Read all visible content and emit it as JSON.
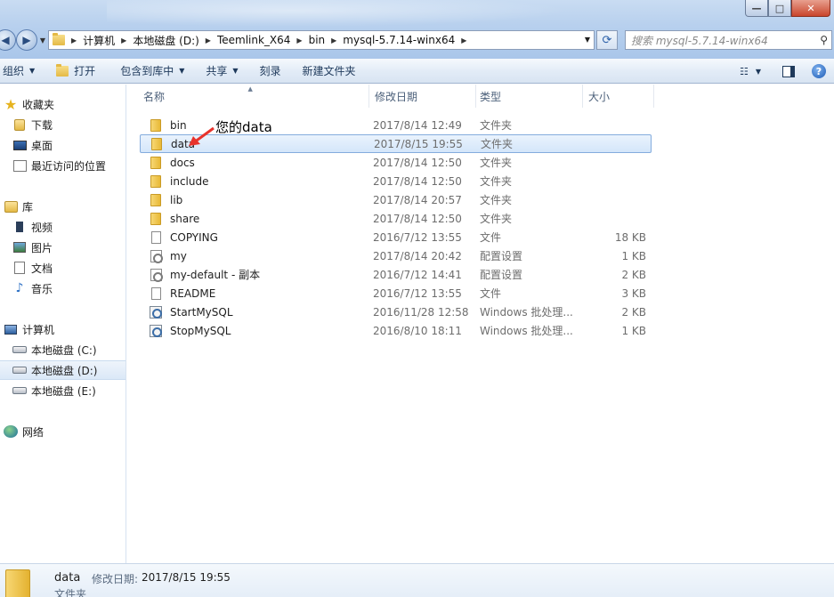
{
  "window": {
    "minimize": "—",
    "maximize": "□",
    "close": "✕"
  },
  "address": {
    "segments": [
      "计算机",
      "本地磁盘 (D:)",
      "Teemlink_X64",
      "bin",
      "mysql-5.7.14-winx64"
    ]
  },
  "search": {
    "placeholder": "搜索 mysql-5.7.14-winx64"
  },
  "toolbar": {
    "organize": "组织",
    "open": "打开",
    "include_in_library": "包含到库中",
    "share": "共享",
    "burn": "刻录",
    "new_folder": "新建文件夹"
  },
  "sidebar": {
    "favorites": "收藏夹",
    "downloads": "下载",
    "desktop": "桌面",
    "recent": "最近访问的位置",
    "libraries": "库",
    "videos": "视频",
    "pictures": "图片",
    "documents": "文档",
    "music": "音乐",
    "computer": "计算机",
    "drive_c": "本地磁盘 (C:)",
    "drive_d": "本地磁盘 (D:)",
    "drive_e": "本地磁盘 (E:)",
    "network": "网络"
  },
  "columns": {
    "name": "名称",
    "date": "修改日期",
    "type": "类型",
    "size": "大小"
  },
  "files": [
    {
      "name": "bin",
      "date": "2017/8/14 12:49",
      "type": "文件夹",
      "size": "",
      "icon": "folder-icon"
    },
    {
      "name": "data",
      "date": "2017/8/15 19:55",
      "type": "文件夹",
      "size": "",
      "icon": "folder-icon"
    },
    {
      "name": "docs",
      "date": "2017/8/14 12:50",
      "type": "文件夹",
      "size": "",
      "icon": "folder-icon"
    },
    {
      "name": "include",
      "date": "2017/8/14 12:50",
      "type": "文件夹",
      "size": "",
      "icon": "folder-icon"
    },
    {
      "name": "lib",
      "date": "2017/8/14 20:57",
      "type": "文件夹",
      "size": "",
      "icon": "folder-icon"
    },
    {
      "name": "share",
      "date": "2017/8/14 12:50",
      "type": "文件夹",
      "size": "",
      "icon": "folder-icon"
    },
    {
      "name": "COPYING",
      "date": "2016/7/12 13:55",
      "type": "文件",
      "size": "18 KB",
      "icon": "file-icon"
    },
    {
      "name": "my",
      "date": "2017/8/14 20:42",
      "type": "配置设置",
      "size": "1 KB",
      "icon": "config-icon"
    },
    {
      "name": "my-default - 副本",
      "date": "2016/7/12 14:41",
      "type": "配置设置",
      "size": "2 KB",
      "icon": "config-icon"
    },
    {
      "name": "README",
      "date": "2016/7/12 13:55",
      "type": "文件",
      "size": "3 KB",
      "icon": "file-icon"
    },
    {
      "name": "StartMySQL",
      "date": "2016/11/28 12:58",
      "type": "Windows 批处理...",
      "size": "2 KB",
      "icon": "batch-icon"
    },
    {
      "name": "StopMySQL",
      "date": "2016/8/10 18:11",
      "type": "Windows 批处理...",
      "size": "1 KB",
      "icon": "batch-icon"
    }
  ],
  "selected_index": 1,
  "annotation": "您的data",
  "details": {
    "name": "data",
    "modified_label": "修改日期:",
    "modified_value": "2017/8/15 19:55",
    "type": "文件夹"
  },
  "colors": {
    "selection_border": "#84acdd",
    "annotation_arrow": "#e8332c"
  }
}
